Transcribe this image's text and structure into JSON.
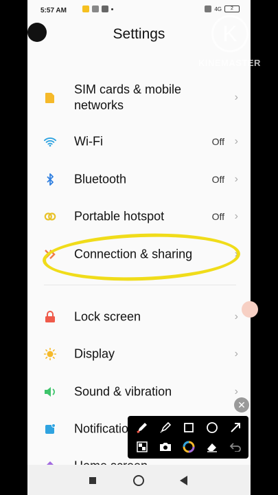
{
  "status_bar": {
    "time": "5:57 AM",
    "signal_text": "4G",
    "battery_text": "2"
  },
  "header": {
    "title": "Settings"
  },
  "items": [
    {
      "label": "SIM cards & mobile networks",
      "value": "",
      "icon": "sim-card-icon",
      "color": "#f5b92a"
    },
    {
      "label": "Wi-Fi",
      "value": "Off",
      "icon": "wifi-icon",
      "color": "#2fa3e0"
    },
    {
      "label": "Bluetooth",
      "value": "Off",
      "icon": "bluetooth-icon",
      "color": "#2f7fe0"
    },
    {
      "label": "Portable hotspot",
      "value": "Off",
      "icon": "hotspot-icon",
      "color": "#e8c22a"
    },
    {
      "label": "Connection & sharing",
      "value": "",
      "icon": "connection-sharing-icon",
      "color": "#ef7a4a"
    },
    {
      "label": "Lock screen",
      "value": "",
      "icon": "lock-icon",
      "color": "#ef5a4a"
    },
    {
      "label": "Display",
      "value": "",
      "icon": "sun-icon",
      "color": "#f5b92a"
    },
    {
      "label": "Sound & vibration",
      "value": "",
      "icon": "speaker-icon",
      "color": "#3dc46a"
    },
    {
      "label": "Notifications",
      "value": "",
      "icon": "notification-icon",
      "color": "#2fa3e0"
    },
    {
      "label": "Home screen",
      "value": "",
      "icon": "home-icon",
      "color": "#a26ae0"
    }
  ],
  "watermark": {
    "text": "KINEMASTER",
    "letter": "K"
  }
}
